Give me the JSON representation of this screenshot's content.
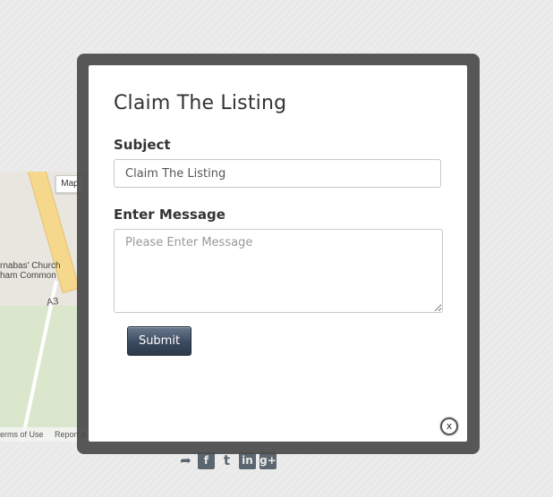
{
  "map": {
    "type_button": "Map",
    "place_label_line1": "rnabas' Church",
    "place_label_line2": "ham Common",
    "road_label": "A3",
    "footer_terms": "erms of Use",
    "footer_report": "Report a"
  },
  "modal": {
    "title": "Claim The Listing",
    "subject_label": "Subject",
    "subject_value": "Claim The Listing",
    "message_label": "Enter Message",
    "message_placeholder": "Please Enter Message",
    "submit_label": "Submit",
    "close_label": "x"
  },
  "social": {
    "icons": [
      "share-icon",
      "facebook-icon",
      "twitter-icon",
      "linkedin-icon",
      "google-plus-icon"
    ]
  }
}
